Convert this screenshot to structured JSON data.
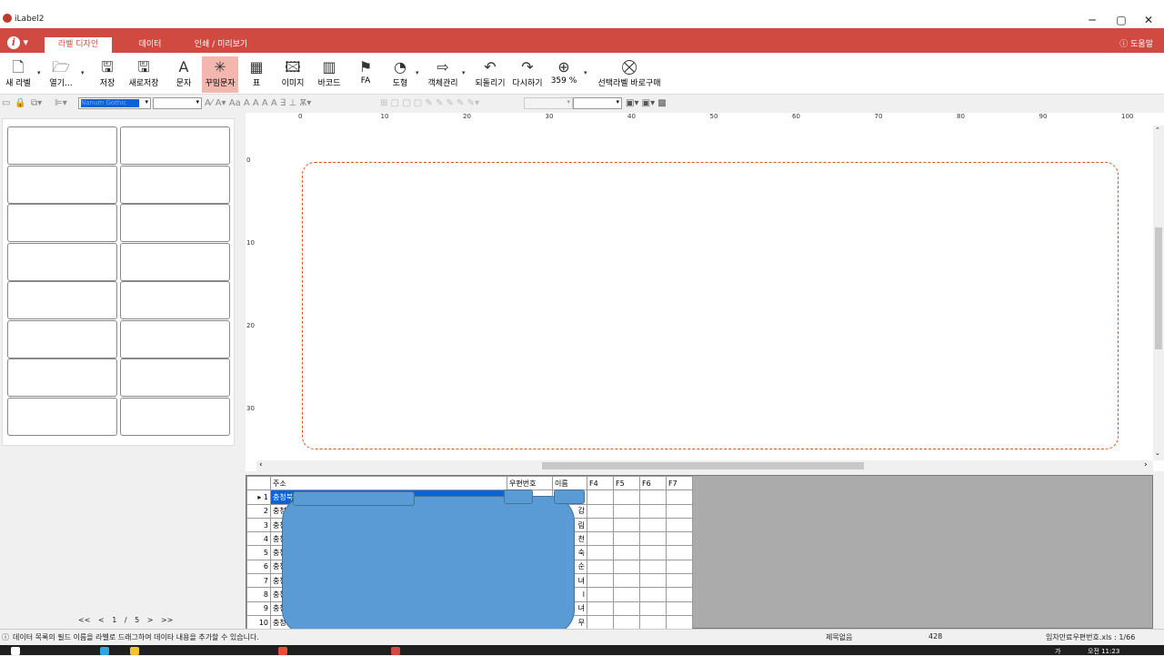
{
  "window": {
    "title": "iLabel2",
    "minimize": "─",
    "maximize": "▢",
    "close": "✕"
  },
  "ribbon": {
    "tabs": [
      {
        "label": "라벨 디자인"
      },
      {
        "label": "데이터"
      },
      {
        "label": "인쇄 / 미리보기"
      }
    ],
    "active_tab": "라벨 디자인",
    "help": "도움말",
    "accent_color": "#d04a42"
  },
  "toolbar": {
    "items": [
      {
        "label": "새 라벨",
        "icon": "new-label-icon"
      },
      {
        "label": "열기...",
        "icon": "open-folder-icon"
      },
      {
        "label": "저장",
        "icon": "save-icon"
      },
      {
        "label": "새로저장",
        "icon": "save-as-icon"
      },
      {
        "label": "문자",
        "icon": "text-icon"
      },
      {
        "label": "꾸밈문자",
        "icon": "styled-text-icon"
      },
      {
        "label": "표",
        "icon": "table-icon"
      },
      {
        "label": "이미지",
        "icon": "image-icon"
      },
      {
        "label": "바코드",
        "icon": "barcode-icon"
      },
      {
        "label": "FA",
        "icon": "fa-icon"
      },
      {
        "label": "도형",
        "icon": "shape-icon"
      },
      {
        "label": "객체관리",
        "icon": "object-manage-icon"
      },
      {
        "label": "되돌리기",
        "icon": "undo-icon"
      },
      {
        "label": "다시하기",
        "icon": "redo-icon"
      },
      {
        "label": "359 %",
        "icon": "zoom-icon"
      },
      {
        "label": "선택라벨 바로구매",
        "icon": "basket-icon"
      }
    ],
    "selected": "꾸밈문자"
  },
  "format": {
    "font": "Nanum Gothic"
  },
  "ruler": {
    "h_labels": [
      "0",
      "10",
      "20",
      "30",
      "40",
      "50",
      "60",
      "70",
      "80",
      "90",
      "100"
    ],
    "v_labels": [
      "0",
      "10",
      "20",
      "30"
    ]
  },
  "pager": {
    "first": "<<",
    "prev": "<",
    "page": "1 / 5",
    "next": ">",
    "last": ">>"
  },
  "grid": {
    "columns": [
      "주소",
      "우편번호",
      "이름",
      "F4",
      "F5",
      "F6",
      "F7"
    ],
    "rows": [
      {
        "n": "1",
        "addr": "충청북",
        "name": ""
      },
      {
        "n": "2",
        "addr": "충청",
        "name": "감"
      },
      {
        "n": "3",
        "addr": "충청",
        "name": "림"
      },
      {
        "n": "4",
        "addr": "충청",
        "name": "천"
      },
      {
        "n": "5",
        "addr": "충청",
        "name": "숙"
      },
      {
        "n": "6",
        "addr": "충청",
        "name": "순"
      },
      {
        "n": "7",
        "addr": "충청",
        "name": "녀"
      },
      {
        "n": "8",
        "addr": "충청",
        "name": "l"
      },
      {
        "n": "9",
        "addr": "충청",
        "name": "녀"
      },
      {
        "n": "10",
        "addr": "충청",
        "name": "무"
      }
    ]
  },
  "status": {
    "hint": "데이터 목록의 필드 이름을 라벨로 드래그하여 데이타 내용을 추가할 수 있습니다.",
    "title": "제목없음",
    "code": "428",
    "file": "임차만료우편번호.xls : 1/66"
  },
  "taskbar": {
    "time": "오전 11:23",
    "locale": "가"
  }
}
